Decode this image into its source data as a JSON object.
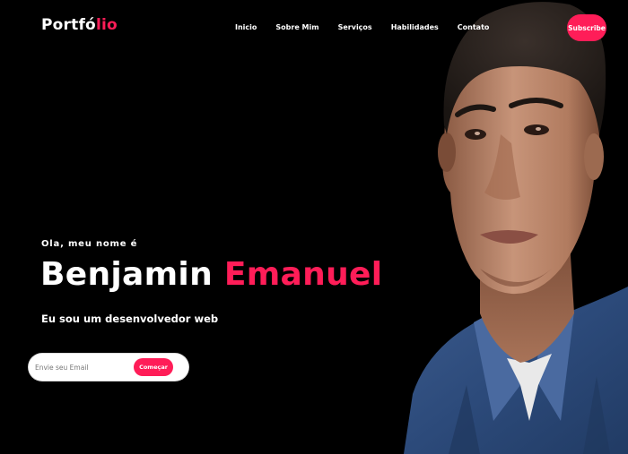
{
  "header": {
    "logo_main": "Portfó",
    "logo_accent": "lio",
    "nav": [
      "Inicio",
      "Sobre Mim",
      "Serviços",
      "Habilidades",
      "Contato"
    ],
    "subscribe_label": "Subscribe"
  },
  "hero": {
    "greeting": "Ola, meu nome é",
    "first_name": "Benjamin",
    "last_name": "Emanuel",
    "role": "Eu sou um desenvolvedor web"
  },
  "form": {
    "email_placeholder": "Envie seu Email",
    "start_label": "Começar"
  },
  "colors": {
    "accent": "#ff1d58",
    "background": "#000000",
    "text": "#ffffff"
  }
}
